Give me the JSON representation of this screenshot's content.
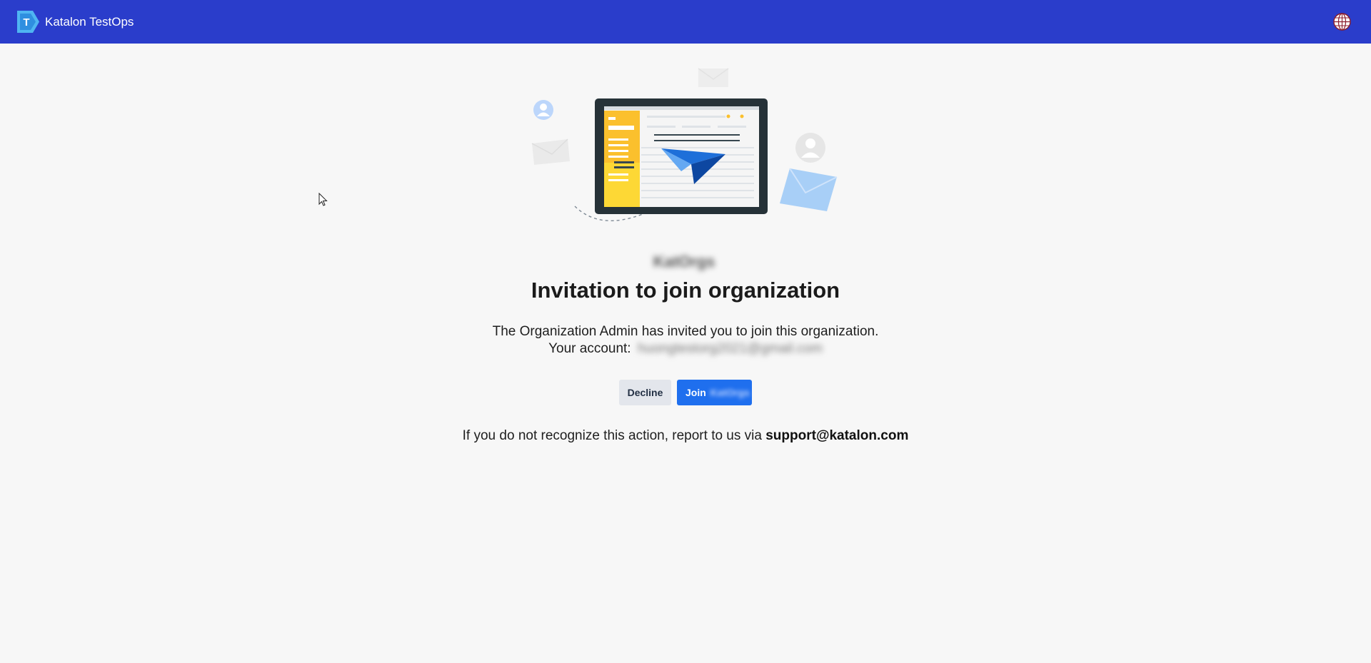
{
  "app": {
    "name": "Katalon TestOps"
  },
  "header": {
    "brand_name": "Katalon TestOps",
    "language_icon": "globe-icon"
  },
  "invitation": {
    "org_name": "KatOrgs",
    "title": "Invitation to join organization",
    "description": "The Organization Admin has invited you to join this organization.",
    "account_label": "Your account:",
    "account_value": "huongtestorg2021@gmail.com",
    "decline_label": "Decline",
    "join_label": "Join",
    "join_org": "KatOrgs"
  },
  "footer": {
    "report_text": "If you do not recognize this action, report to us via",
    "support_email": "support@katalon.com"
  },
  "colors": {
    "header_bg": "#2a3dcb",
    "page_bg": "#f7f7f7",
    "primary_button": "#1f6fee",
    "secondary_button": "#e3e6ec"
  }
}
